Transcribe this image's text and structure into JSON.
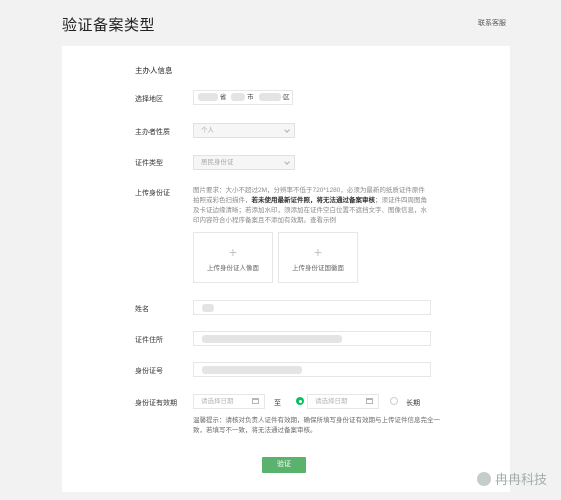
{
  "header": {
    "title": "验证备案类型",
    "contact_link": "联系客服"
  },
  "form": {
    "section_title": "主办人信息",
    "region": {
      "label": "选择地区",
      "province_suffix": "省",
      "city_suffix": "市",
      "district_suffix": "区"
    },
    "sponsor_nature": {
      "label": "主办者性质",
      "value": "个人"
    },
    "id_type": {
      "label": "证件类型",
      "value": "居民身份证"
    },
    "upload": {
      "label": "上传身份证",
      "tip_prefix": "图片要求：大小不超过2M，分辨率不低于720*1280，必须为最新的纸质证件原件拍照或彩色扫描件，",
      "tip_bold": "若未使用最新证件照，将无法通过备案审核",
      "tip_suffix": "；须证件四周图角及卡证边缘清晰；若添加水印，须添加在证件空白位置不遮挡文字、图像信息，水印内容符合小程序备案且不添加有效期。查看示例",
      "front_label": "上传身份证人像面",
      "back_label": "上传身份证国徽面"
    },
    "name": {
      "label": "姓名"
    },
    "address": {
      "label": "证件住所"
    },
    "id_number": {
      "label": "身份证号"
    },
    "validity": {
      "label": "身份证有效期",
      "start_placeholder": "请选择日期",
      "separator": "至",
      "end_placeholder": "请选择日期",
      "long_term_label": "长期"
    },
    "hint": "温馨提示：请核对负责人证件有效期，确保所填写身份证有效期与上传证件信息完全一致，若填写不一致，将无法通过备案审核。",
    "submit_label": "验证"
  },
  "watermark": "冉冉科技",
  "colors": {
    "accent": "#07c160",
    "button": "#5ab36c",
    "page_bg": "#f2f2f2"
  }
}
